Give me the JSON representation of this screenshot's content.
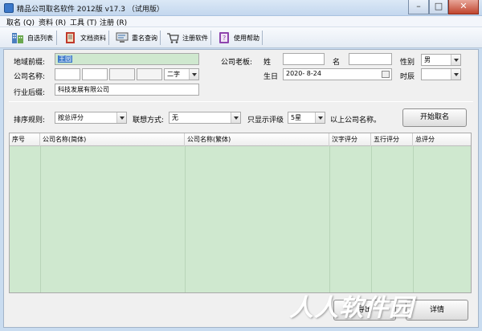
{
  "window": {
    "title": "精品公司取名软件 2012版 v17.3 （试用版）",
    "controls": [
      "–",
      "□",
      "✕"
    ]
  },
  "menu": [
    "取名 (Q)",
    "资料 (R)",
    "工具 (T)",
    "注册 (R)"
  ],
  "toolbar": {
    "items": [
      {
        "label": "自选列表",
        "icon": "building-list-icon"
      },
      {
        "label": "文档资料",
        "icon": "document-book-icon"
      },
      {
        "label": "重名查询",
        "icon": "monitor-search-icon"
      },
      {
        "label": "注册软件",
        "icon": "cart-icon"
      },
      {
        "label": "使用帮助",
        "icon": "help-book-icon"
      }
    ]
  },
  "form": {
    "region_label": "地域前缀:",
    "region_value": "王园",
    "company_name_label": "公司名称:",
    "name_length": "二字",
    "industry_label": "行业后缀:",
    "industry_value": "科技发展有限公司",
    "owner_label": "公司老板:",
    "surname_label": "姓",
    "given_label": "名",
    "gender_label": "性别",
    "gender_value": "男",
    "birthday_label": "生日",
    "birthday_value": "2020- 8-24",
    "birth_hour_label": "时辰",
    "birth_hour_value": ""
  },
  "options": {
    "sort_label": "排序规则:",
    "sort_value": "按总评分",
    "assoc_label": "联想方式:",
    "assoc_value": "无",
    "only_show_label": "只显示评级",
    "rating_value": "5星",
    "suffix_label": "以上公司名称。",
    "start_button": "开始取名"
  },
  "table": {
    "columns": [
      "序号",
      "公司名称(简体)",
      "公司名称(繁体)",
      "汉字评分",
      "五行评分",
      "总评分"
    ]
  },
  "bottom": {
    "button1": "导出",
    "button2": "详情"
  },
  "watermark": "人人软件园",
  "colors": {
    "grid_bg": "#cfe8cf",
    "title_bg": "#c3d7ee"
  }
}
